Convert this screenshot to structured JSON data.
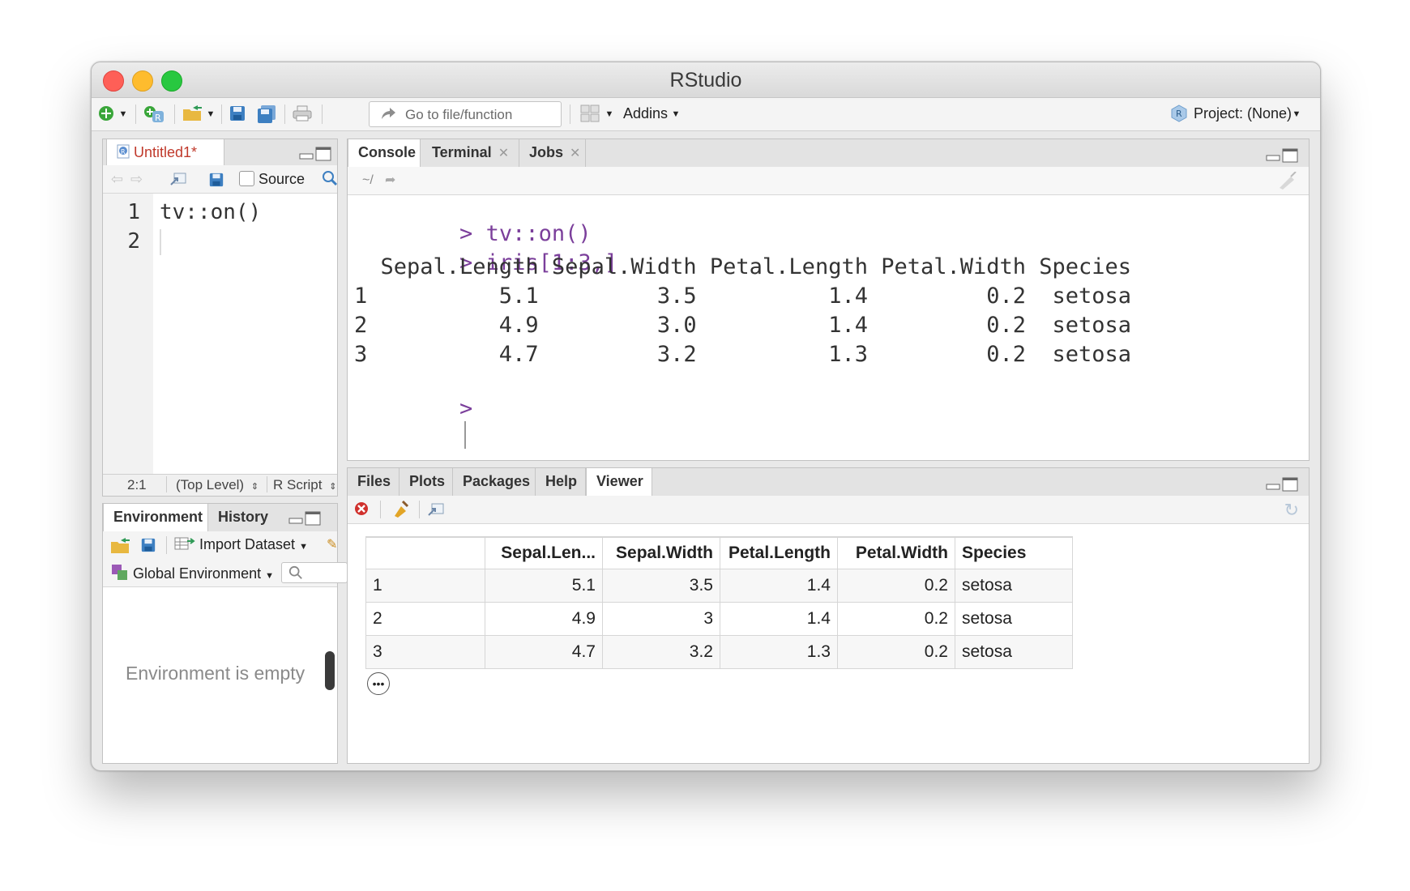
{
  "window": {
    "title": "RStudio",
    "traffic_colors": [
      "#fe5f57",
      "#febc2e",
      "#28c840"
    ]
  },
  "toolbar": {
    "goto_placeholder": "Go to file/function",
    "addins_label": "Addins",
    "project_label": "Project: (None)"
  },
  "source_pane": {
    "tab_label": "Untitled1*",
    "source_label": "Source",
    "lines": [
      "tv::on()",
      ""
    ],
    "line_numbers": [
      "1",
      "2"
    ],
    "status_position": "2:1",
    "status_scope": "(Top Level)",
    "status_filetype": "R Script"
  },
  "env_pane": {
    "tabs": [
      "Environment",
      "History"
    ],
    "import_label": "Import Dataset",
    "scope_label": "Global Environment",
    "empty_message": "Environment is empty"
  },
  "console_pane": {
    "tabs": [
      "Console",
      "Terminal",
      "Jobs"
    ],
    "path": "~/",
    "lines": [
      {
        "prompt": ">",
        "text": "tv::on()",
        "kind": "cmd"
      },
      {
        "prompt": ">",
        "text": "iris[1:3,]",
        "kind": "cmd"
      },
      {
        "prompt": "",
        "text": "  Sepal.Length Sepal.Width Petal.Length Petal.Width Species",
        "kind": "out"
      },
      {
        "prompt": "",
        "text": "1          5.1         3.5          1.4         0.2  setosa",
        "kind": "out"
      },
      {
        "prompt": "",
        "text": "2          4.9         3.0          1.4         0.2  setosa",
        "kind": "out"
      },
      {
        "prompt": "",
        "text": "3          4.7         3.2          1.3         0.2  setosa",
        "kind": "out"
      },
      {
        "prompt": ">",
        "text": "",
        "kind": "cmd"
      }
    ]
  },
  "viewer_pane": {
    "tabs": [
      "Files",
      "Plots",
      "Packages",
      "Help",
      "Viewer"
    ],
    "active_tab": "Viewer",
    "table": {
      "columns": [
        "",
        "Sepal.Len...",
        "Sepal.Width",
        "Petal.Length",
        "Petal.Width",
        "Species"
      ],
      "rows": [
        [
          "1",
          "5.1",
          "3.5",
          "1.4",
          "0.2",
          "setosa"
        ],
        [
          "2",
          "4.9",
          "3",
          "1.4",
          "0.2",
          "setosa"
        ],
        [
          "3",
          "4.7",
          "3.2",
          "1.3",
          "0.2",
          "setosa"
        ]
      ]
    },
    "more_label": "•••"
  }
}
